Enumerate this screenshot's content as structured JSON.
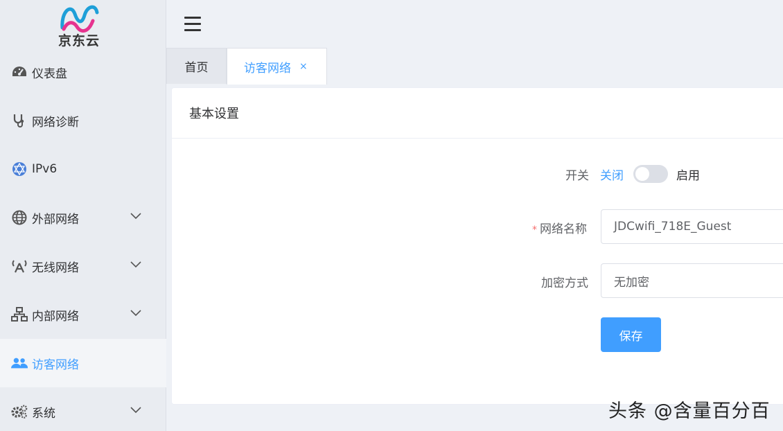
{
  "brand": {
    "logo_text": "京东云",
    "colors": {
      "accent": "#409eff",
      "logo_pink": "#e6338f",
      "logo_blue": "#1e9fd8"
    }
  },
  "sidebar": {
    "items": [
      {
        "label": "仪表盘",
        "icon": "dashboard-icon",
        "has_submenu": false,
        "active": false
      },
      {
        "label": "网络诊断",
        "icon": "stethoscope-icon",
        "has_submenu": false,
        "active": false
      },
      {
        "label": "IPv6",
        "icon": "ipv6-network-icon",
        "has_submenu": false,
        "active": false
      },
      {
        "label": "外部网络",
        "icon": "globe-icon",
        "has_submenu": true,
        "active": false
      },
      {
        "label": "无线网络",
        "icon": "wireless-antenna-icon",
        "has_submenu": true,
        "active": false
      },
      {
        "label": "内部网络",
        "icon": "lan-sitemap-icon",
        "has_submenu": true,
        "active": false
      },
      {
        "label": "访客网络",
        "icon": "users-icon",
        "has_submenu": false,
        "active": true
      },
      {
        "label": "系统",
        "icon": "gears-icon",
        "has_submenu": true,
        "active": false
      }
    ]
  },
  "header": {
    "menu_icon": "hamburger-icon"
  },
  "tabs": [
    {
      "label": "首页",
      "active": false,
      "closable": false
    },
    {
      "label": "访客网络",
      "active": true,
      "closable": true,
      "close_glyph": "×"
    }
  ],
  "card": {
    "title": "基本设置",
    "switch": {
      "label": "开关",
      "off_text": "关闭",
      "on_text": "启用",
      "enabled": false
    },
    "ssid": {
      "label": "网络名称",
      "required_mark": "*",
      "value": "JDCwifi_718E_Guest"
    },
    "encryption": {
      "label": "加密方式",
      "value": "无加密"
    },
    "save_label": "保存"
  },
  "watermark": "头条 @含量百分百"
}
